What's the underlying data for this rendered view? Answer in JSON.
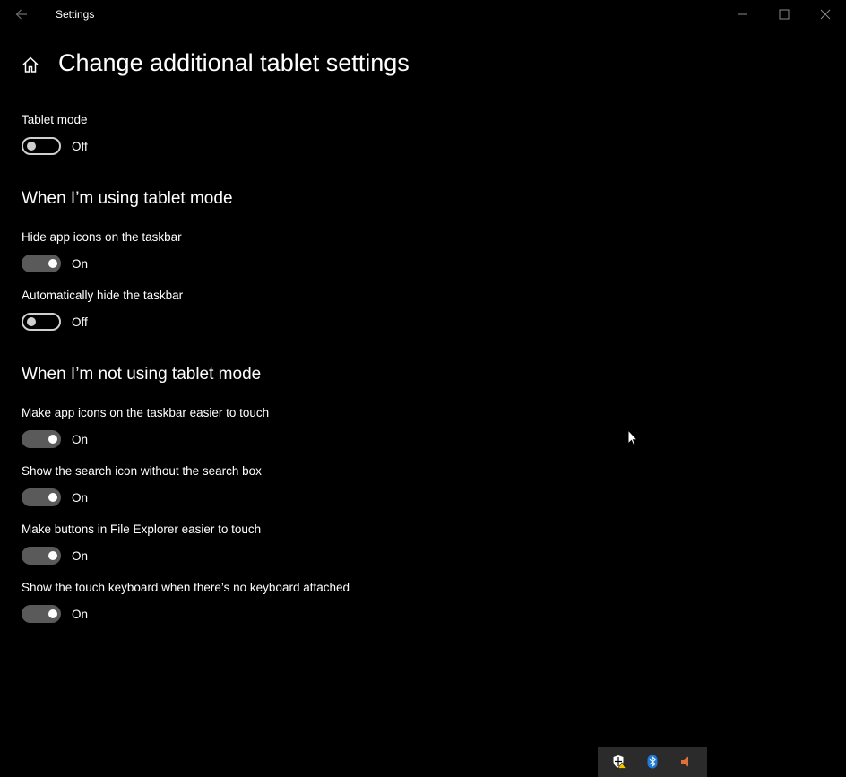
{
  "window": {
    "title": "Settings"
  },
  "header": {
    "page_title": "Change additional tablet settings"
  },
  "tablet_mode": {
    "label": "Tablet mode",
    "state": "Off"
  },
  "using_tablet": {
    "heading": "When I’m using tablet mode",
    "settings": [
      {
        "label": "Hide app icons on the taskbar",
        "state": "On"
      },
      {
        "label": "Automatically hide the taskbar",
        "state": "Off"
      }
    ]
  },
  "not_using_tablet": {
    "heading": "When I’m not using tablet mode",
    "settings": [
      {
        "label": "Make app icons on the taskbar easier to touch",
        "state": "On"
      },
      {
        "label": "Show the search icon without the search box",
        "state": "On"
      },
      {
        "label": "Make buttons in File Explorer easier to touch",
        "state": "On"
      },
      {
        "label": "Show the touch keyboard when there’s no keyboard attached",
        "state": "On"
      }
    ]
  },
  "tray": {
    "icons": [
      "security-warning-icon",
      "bluetooth-icon",
      "speaker-muted-icon"
    ]
  },
  "colors": {
    "background": "#000000",
    "toggle_on": "#5a5a5a",
    "toggle_off_border": "#cfcfcf",
    "bluetooth": "#1e7bd9",
    "speaker": "#e0703a"
  }
}
